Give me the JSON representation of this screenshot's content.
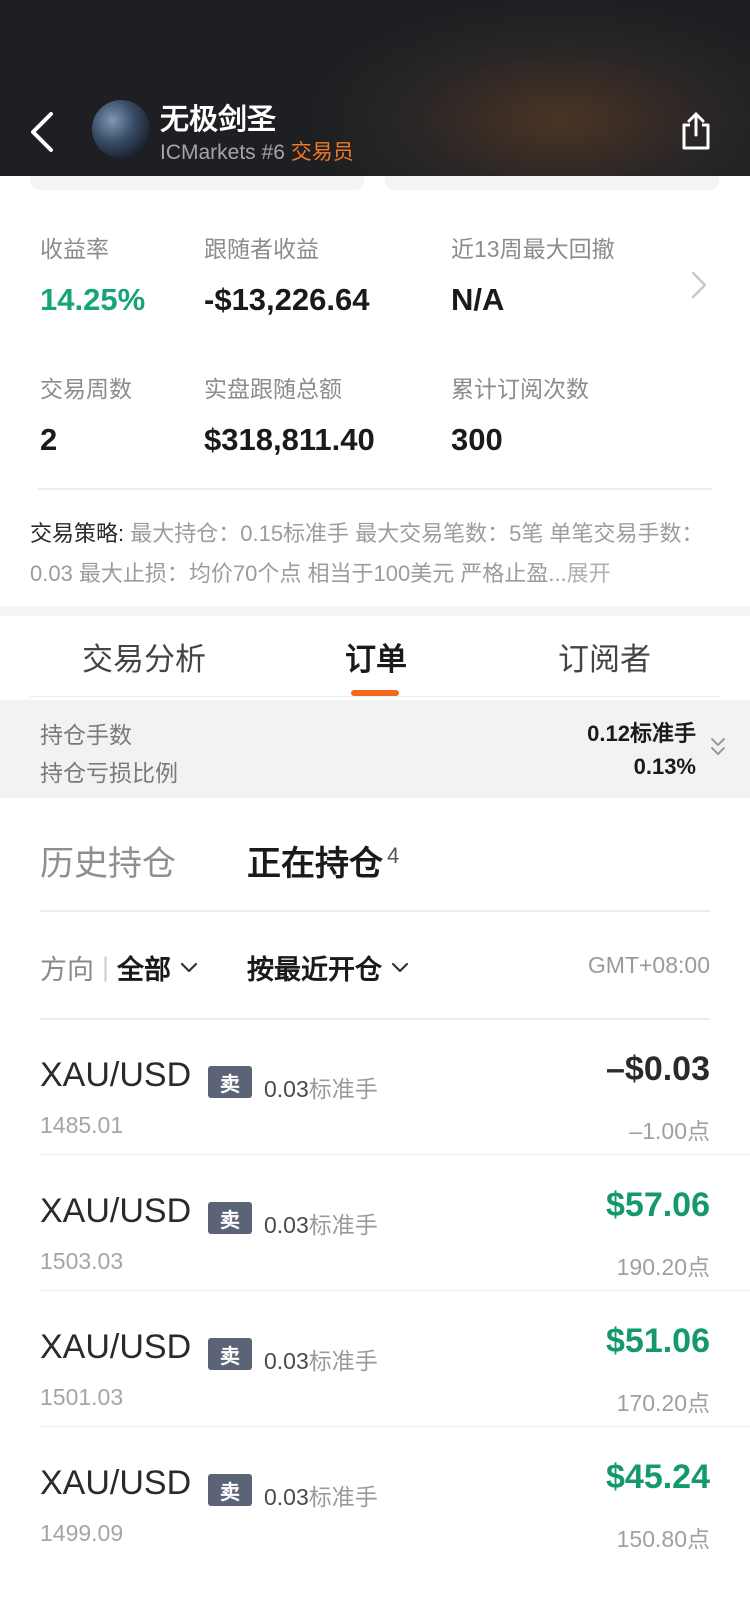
{
  "header": {
    "name": "无极剑圣",
    "broker_line": "ICMarkets #6",
    "role": "交易员"
  },
  "stats": [
    {
      "label": "收益率",
      "value": "14.25%"
    },
    {
      "label": "跟随者收益",
      "value": "-$13,226.64"
    },
    {
      "label": "近13周最大回撤",
      "value": "N/A"
    },
    {
      "label": "交易周数",
      "value": "2"
    },
    {
      "label": "实盘跟随总额",
      "value": "$318,811.40"
    },
    {
      "label": "累计订阅次数",
      "value": "300"
    }
  ],
  "strategy": {
    "label": "交易策略:",
    "text": " 最大持仓：0.15标准手  最大交易笔数：5笔  单笔交易手数：0.03  最大止损：均价70个点  相当于100美元  严格止盈...",
    "expand": "展开"
  },
  "tabs": [
    {
      "label": "交易分析"
    },
    {
      "label": "订单"
    },
    {
      "label": "订阅者"
    }
  ],
  "summary": {
    "lots_label": "持仓手数",
    "lots_value": "0.12标准手",
    "ratio_label": "持仓亏损比例",
    "ratio_value": "0.13%"
  },
  "subtabs": {
    "history": "历史持仓",
    "open": "正在持仓",
    "open_count": "4"
  },
  "filters": {
    "direction_label": "方向",
    "direction_value": "全部",
    "sort_value": "按最近开仓",
    "timezone": "GMT+08:00"
  },
  "orders": [
    {
      "symbol": "XAU/USD",
      "side": "卖",
      "lots": "0.03",
      "unit": "标准手",
      "price": "1485.01",
      "pnl": "–$0.03",
      "points": "–1.00点",
      "positive": false
    },
    {
      "symbol": "XAU/USD",
      "side": "卖",
      "lots": "0.03",
      "unit": "标准手",
      "price": "1503.03",
      "pnl": "$57.06",
      "points": "190.20点",
      "positive": true
    },
    {
      "symbol": "XAU/USD",
      "side": "卖",
      "lots": "0.03",
      "unit": "标准手",
      "price": "1501.03",
      "pnl": "$51.06",
      "points": "170.20点",
      "positive": true
    },
    {
      "symbol": "XAU/USD",
      "side": "卖",
      "lots": "0.03",
      "unit": "标准手",
      "price": "1499.09",
      "pnl": "$45.24",
      "points": "150.80点",
      "positive": true
    }
  ]
}
